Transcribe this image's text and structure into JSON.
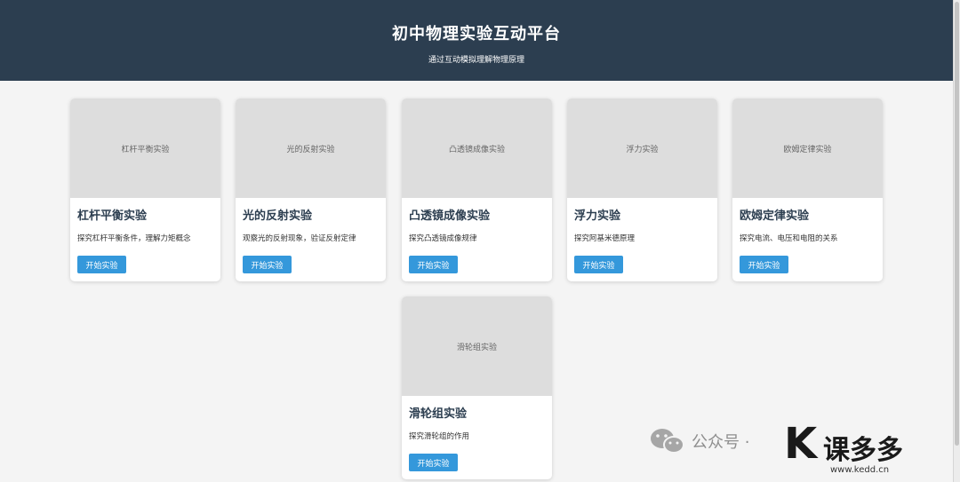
{
  "header": {
    "title": "初中物理实验互动平台",
    "subtitle": "通过互动模拟理解物理原理"
  },
  "cards": [
    {
      "image_label": "杠杆平衡实验",
      "title": "杠杆平衡实验",
      "desc": "探究杠杆平衡条件，理解力矩概念",
      "button": "开始实验"
    },
    {
      "image_label": "光的反射实验",
      "title": "光的反射实验",
      "desc": "观察光的反射现象，验证反射定律",
      "button": "开始实验"
    },
    {
      "image_label": "凸透镜成像实验",
      "title": "凸透镜成像实验",
      "desc": "探究凸透镜成像规律",
      "button": "开始实验"
    },
    {
      "image_label": "浮力实验",
      "title": "浮力实验",
      "desc": "探究阿基米德原理",
      "button": "开始实验"
    },
    {
      "image_label": "欧姆定律实验",
      "title": "欧姆定律实验",
      "desc": "探究电流、电压和电阻的关系",
      "button": "开始实验"
    },
    {
      "image_label": "滑轮组实验",
      "title": "滑轮组实验",
      "desc": "探究滑轮组的作用",
      "button": "开始实验"
    }
  ],
  "watermark": {
    "wechat_label": "公众号 ·",
    "logo_letter": "K",
    "brand": "课多多",
    "url": "www.kedd.cn"
  },
  "colors": {
    "header_bg": "#2c3e50",
    "accent": "#3498db",
    "page_bg": "#f4f4f4"
  }
}
